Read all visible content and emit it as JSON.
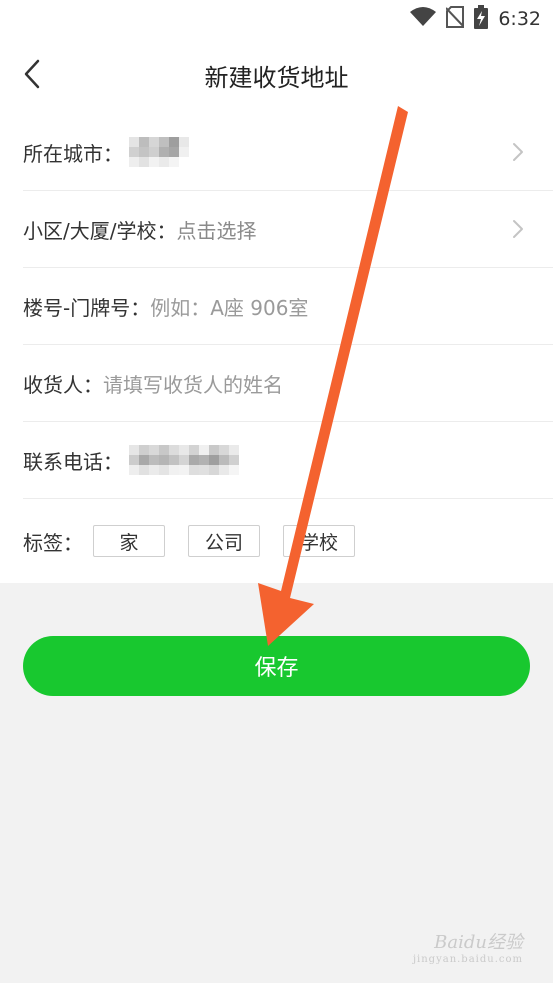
{
  "status_bar": {
    "time": "6:32"
  },
  "header": {
    "title": "新建收货地址"
  },
  "form": {
    "city": {
      "label": "所在城市："
    },
    "community": {
      "label": "小区/大厦/学校：",
      "placeholder": "点击选择"
    },
    "building": {
      "label": "楼号-门牌号：",
      "placeholder": "例如：A座 906室"
    },
    "receiver": {
      "label": "收货人：",
      "placeholder": "请填写收货人的姓名"
    },
    "phone": {
      "label": "联系电话："
    },
    "tags": {
      "label": "标签：",
      "options": [
        "家",
        "公司",
        "学校"
      ]
    }
  },
  "save_button": {
    "label": "保存"
  },
  "watermark": {
    "text": "Baidu经验",
    "sub": "jingyan.baidu.com"
  },
  "colors": {
    "accent_green": "#18c82f",
    "annotation_arrow": "#f4622f"
  }
}
